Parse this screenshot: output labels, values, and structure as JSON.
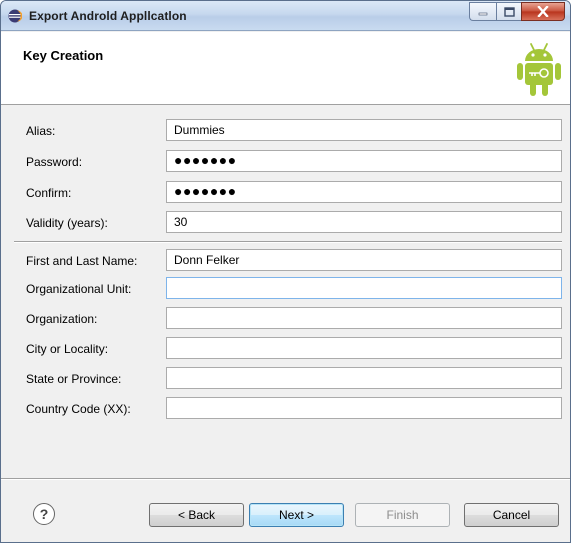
{
  "window": {
    "title": "Export Androld Appllcatlon"
  },
  "header": {
    "title": "Key Creation",
    "logo_icon": "android-logo-icon"
  },
  "form": {
    "alias": {
      "label": "Alias:",
      "value": "Dummies"
    },
    "password": {
      "label": "Password:",
      "value": "●●●●●●●"
    },
    "confirm": {
      "label": "Confirm:",
      "value": "●●●●●●●"
    },
    "validity": {
      "label": "Validity (years):",
      "value": "30"
    },
    "name": {
      "label": "First and Last Name:",
      "value": "Donn Felker"
    },
    "org_unit": {
      "label": "Organizational Unit:",
      "value": ""
    },
    "organization": {
      "label": "Organization:",
      "value": ""
    },
    "city": {
      "label": "City or Locality:",
      "value": ""
    },
    "state": {
      "label": "State or Province:",
      "value": ""
    },
    "country": {
      "label": "Country Code (XX):",
      "value": ""
    }
  },
  "footer": {
    "help_label": "?",
    "back_label": "< Back",
    "next_label": "Next >",
    "finish_label": "Finish",
    "cancel_label": "Cancel"
  },
  "colors": {
    "android_green": "#a4c639",
    "title_bar": "#c6d8ee",
    "close_button": "#c8503a"
  }
}
